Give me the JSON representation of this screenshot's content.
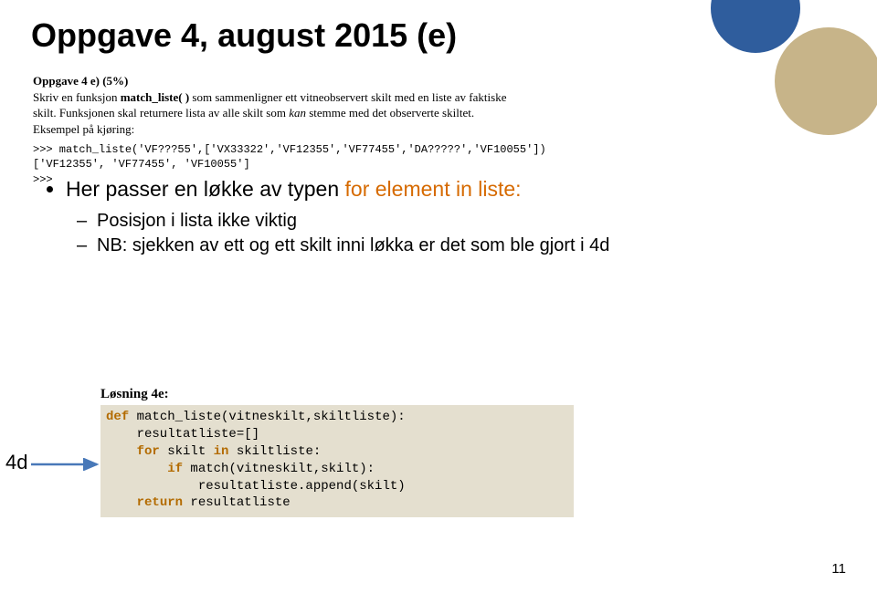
{
  "title": "Oppgave 4, august 2015 (e)",
  "problem": {
    "header": "Oppgave 4 e) (5%)",
    "line1_pre": "Skriv en funksjon ",
    "line1_bold": "match_liste( )",
    "line1_post": " som sammenligner ett vitneobservert skilt med en liste av faktiske",
    "line2_pre": "skilt. Funksjonen skal returnere lista av alle skilt som ",
    "line2_ital": "kan",
    "line2_post": " stemme med det observerte skiltet.",
    "line3": "Eksempel på kjøring:",
    "code1": ">>> match_liste('VF???55',['VX33322','VF12355','VF77455','DA?????','VF10055'])",
    "code2": "['VF12355', 'VF77455', 'VF10055']",
    "code3": ">>>"
  },
  "bullets": {
    "l1_pre": "Her passer en løkke av typen ",
    "l1_kw_for": "for",
    "l1_mid": " element ",
    "l1_kw_in": "in",
    "l1_post": " liste:",
    "l2": "Posisjon i lista ikke viktig",
    "l3": "NB: sjekken av ett og ett skilt inni løkka er det som ble gjort i 4d"
  },
  "solution": {
    "label": "Løsning 4e:",
    "kw_def": "def",
    "fn_sig": " match_liste(vitneskilt,skiltliste):",
    "line2": "    resultatliste=[]",
    "kw_for": "for",
    "for_rest": " skilt ",
    "kw_in": "in",
    "for_rest2": " skiltliste:",
    "kw_if": "if",
    "if_rest": " match(vitneskilt,skilt):",
    "line5": "            resultatliste.append(skilt)",
    "kw_return": "return",
    "ret_rest": " resultatliste"
  },
  "annotation_4d": "4d",
  "page_number": "11"
}
